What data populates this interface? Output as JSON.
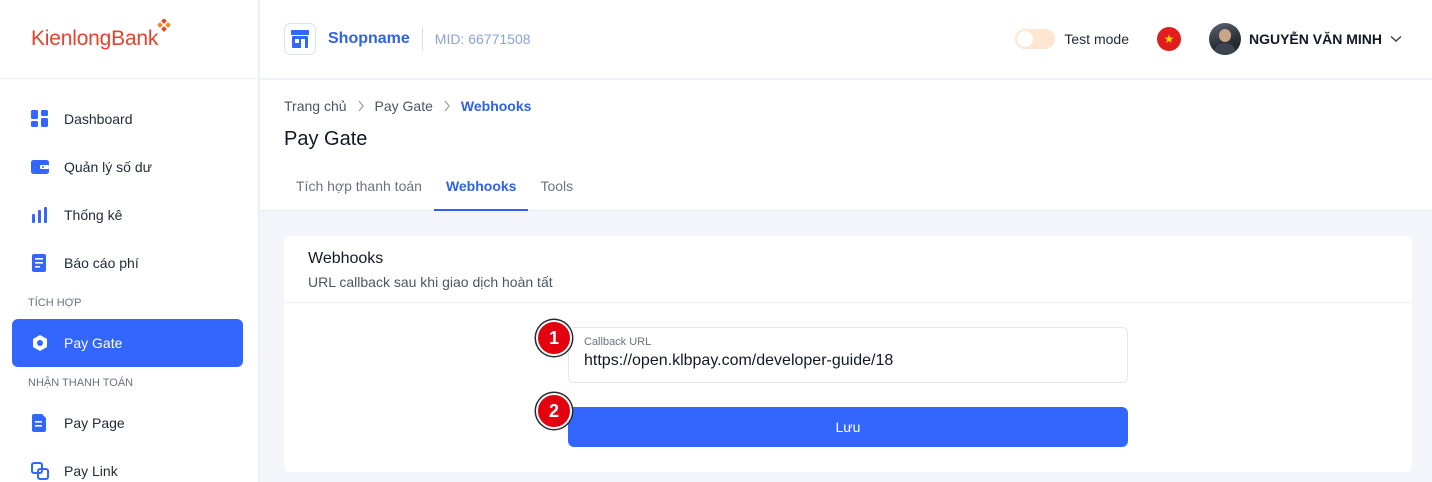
{
  "brand": {
    "logo_text_a": "Kienlong",
    "logo_text_b": "Bank"
  },
  "header": {
    "shop_name": "Shopname",
    "mid": "MID: 66771508",
    "test_mode_label": "Test mode",
    "user_name": "NGUYỄN VĂN MINH",
    "flag_star": "★"
  },
  "sidebar": {
    "items": [
      {
        "label": "Dashboard"
      },
      {
        "label": "Quản lý số dư"
      },
      {
        "label": "Thống kê"
      },
      {
        "label": "Báo cáo phí"
      }
    ],
    "section_integration": "TÍCH HỢP",
    "active_item": "Pay Gate",
    "section_payment": "NHẬN THANH TOÁN",
    "payment_items": [
      {
        "label": "Pay Page"
      },
      {
        "label": "Pay Link"
      }
    ]
  },
  "breadcrumb": {
    "home": "Trang chủ",
    "parent": "Pay Gate",
    "current": "Webhooks"
  },
  "page": {
    "title": "Pay Gate"
  },
  "tabs": [
    {
      "label": "Tích hợp thanh toán"
    },
    {
      "label": "Webhooks"
    },
    {
      "label": "Tools"
    }
  ],
  "card": {
    "title": "Webhooks",
    "subtitle": "URL callback sau khi giao dịch hoàn tất",
    "field_label": "Callback URL",
    "field_value": "https://open.klbpay.com/developer-guide/18",
    "save_label": "Lưu"
  },
  "annotations": {
    "badge_1": "1",
    "badge_2": "2"
  },
  "colors": {
    "primary": "#3366ff",
    "brand_red": "#e8412c",
    "badge_red": "#e3000f"
  }
}
